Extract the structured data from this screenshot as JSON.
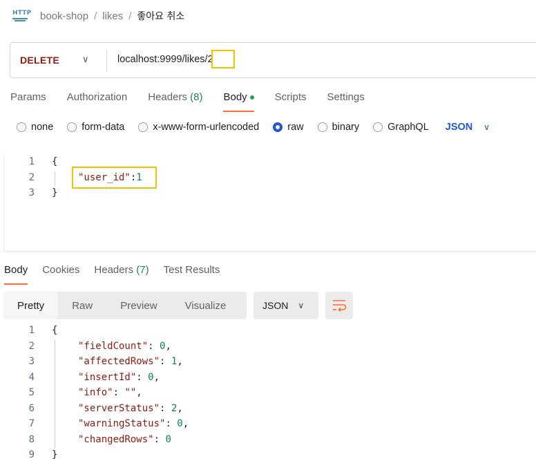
{
  "breadcrumb": {
    "icon": "http-icon",
    "collection": "book-shop",
    "folder": "likes",
    "request": "좋아요 취소",
    "sep": "/"
  },
  "request": {
    "method": "DELETE",
    "url": "localhost:9999/likes/2",
    "tabs": [
      {
        "label": "Params"
      },
      {
        "label": "Authorization"
      },
      {
        "label": "Headers",
        "count": "(8)"
      },
      {
        "label": "Body"
      },
      {
        "label": "Scripts"
      },
      {
        "label": "Settings"
      }
    ],
    "body_options": [
      "none",
      "form-data",
      "x-www-form-urlencoded",
      "raw",
      "binary",
      "GraphQL"
    ],
    "selected_body_option": "raw",
    "body_format": "JSON",
    "body_lines": [
      "1",
      "2",
      "3"
    ]
  },
  "response": {
    "tabs": [
      {
        "label": "Body"
      },
      {
        "label": "Cookies"
      },
      {
        "label": "Headers",
        "count": "(7)"
      },
      {
        "label": "Test Results"
      }
    ],
    "view_modes": [
      "Pretty",
      "Raw",
      "Preview",
      "Visualize"
    ],
    "active_view": "Pretty",
    "format": "JSON",
    "lines": [
      "1",
      "2",
      "3",
      "4",
      "5",
      "6",
      "7",
      "8",
      "9"
    ]
  },
  "colors": {
    "accent": "#ff6c37",
    "method_delete": "#8e1a10",
    "primary_blue": "#1f57d6",
    "highlight": "#f5c000",
    "count_green": "#1e8a4a"
  }
}
